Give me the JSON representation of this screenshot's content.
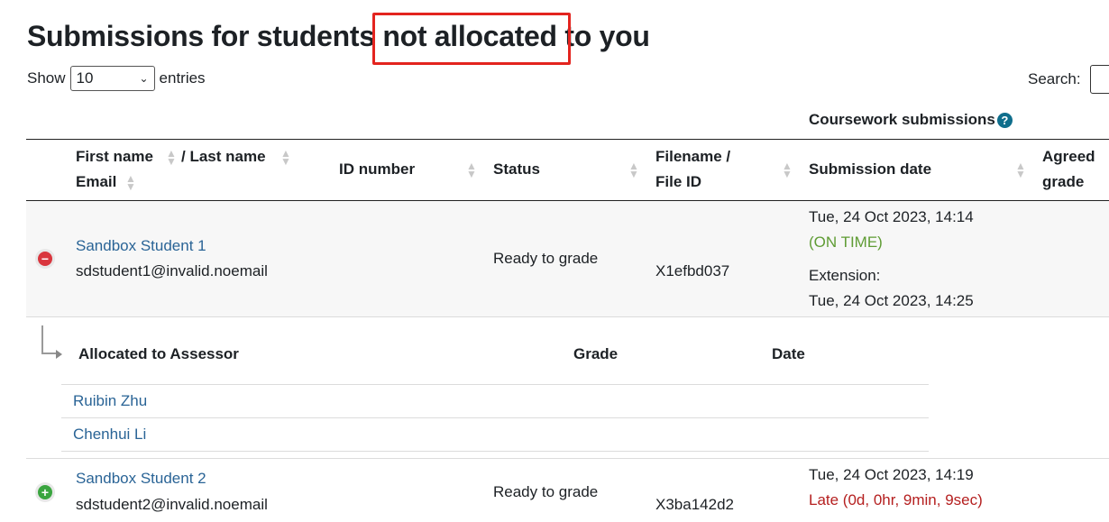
{
  "page": {
    "title": "Submissions for students not allocated to you",
    "highlighted_phrase": "not allocated"
  },
  "length_control": {
    "show_label": "Show",
    "selected": "10",
    "entries_label": "entries"
  },
  "search": {
    "label": "Search:",
    "value": ""
  },
  "table": {
    "group_header": "Coursework submissions",
    "columns": {
      "first_name": "First name",
      "last_name": "/ Last name",
      "email": "Email",
      "id_number": "ID number",
      "status": "Status",
      "filename_1": "Filename /",
      "filename_2": "File ID",
      "submission_date": "Submission date",
      "agreed_1": "Agreed",
      "agreed_2": "grade"
    },
    "rows": [
      {
        "expanded": true,
        "name": "Sandbox Student 1",
        "email": "sdstudent1@invalid.noemail",
        "id_number": "",
        "status": "Ready to grade",
        "file_id": "X1efbd037",
        "submission_date": "Tue, 24 Oct 2023, 14:14",
        "timeliness": "(ON TIME)",
        "extension_label": "Extension:",
        "extension_date": "Tue, 24 Oct 2023, 14:25"
      },
      {
        "expanded": false,
        "name": "Sandbox Student 2",
        "email": "sdstudent2@invalid.noemail",
        "id_number": "",
        "status": "Ready to grade",
        "file_id": "X3ba142d2",
        "submission_date": "Tue, 24 Oct 2023, 14:19",
        "timeliness": "Late (0d, 0hr, 9min, 9sec)"
      }
    ],
    "allocation": {
      "headers": {
        "assessor": "Allocated to Assessor",
        "grade": "Grade",
        "date": "Date"
      },
      "assessors": [
        {
          "name": "Ruibin Zhu",
          "grade": "",
          "date": ""
        },
        {
          "name": "Chenhui Li",
          "grade": "",
          "date": ""
        }
      ]
    }
  },
  "colors": {
    "link": "#2a6496",
    "on_time": "#5f9c34",
    "late": "#b52020",
    "highlight_box": "#e3241f",
    "help_icon": "#0f6e8c",
    "collapse_icon": "#d9363e",
    "expand_icon": "#3aa53f"
  }
}
